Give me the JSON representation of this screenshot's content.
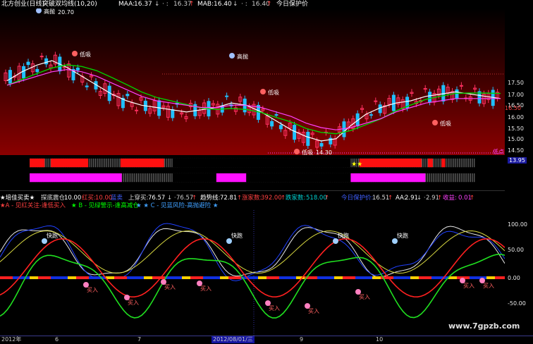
{
  "header": {
    "title": "北方创业(日线)",
    "indicator": "突破双均线(10,20)",
    "maa_label": "MAA:",
    "maa_value": "16.37",
    "maa_value2": "16.37",
    "mab_label": "MAB:",
    "mab_value": "16.40",
    "mab_value2": "16.40",
    "protect_label": "今日保护价"
  },
  "price_axis": {
    "labels": [
      "17.50",
      "17.00",
      "16.50",
      "16.00",
      "15.50",
      "15.00",
      "14.50",
      "13.95"
    ],
    "current_price": "16.50"
  },
  "price_annotations": {
    "high_value": "20.70",
    "low_value": "14.30",
    "high_sell_label": "高抛",
    "low_buy_label": "低吸",
    "low_line_label": "低点"
  },
  "indicator_header": {
    "name": "★培佳买卖★",
    "seg1_label": "探底震仓:",
    "seg1_value": "10.00",
    "seg2_label": "红买:",
    "seg2_value": "10.00",
    "seg3_label": "蓝卖",
    "seg4_label": "上穿买:",
    "seg4_value": "76.57",
    "seg4_value2": "76.57",
    "seg5_label": "趋势线:",
    "seg5_value": "72.81",
    "seg6_label": "涨家数:",
    "seg6_value": "392.00",
    "seg7_label": "跌家数:",
    "seg7_value": "518.00",
    "seg8_label": "今日保护价:",
    "seg8_value": "16.51",
    "seg9_label": "AA:",
    "seg9_value": "2.91",
    "seg9_value2": "2.91",
    "seg10_label": "收益:",
    "seg10_value": "0.01"
  },
  "legend": {
    "a": "★A - 见红关注-逢低买入",
    "b": "★ B - 见绿警示-逢高减仓",
    "c": "★ ★ C - 见蓝风险-高抛避险 ★"
  },
  "osc_axis": {
    "labels": [
      "100.00",
      "50.00",
      "0.00",
      "-50.00"
    ]
  },
  "signals": {
    "run_label": "快跑",
    "buy_label": "买入"
  },
  "date_axis": {
    "year": "2012年",
    "m6": "6",
    "m7": "7",
    "cursor_date": "2012/08/01/三",
    "m9": "9",
    "m10": "10"
  },
  "watermark": "www.7gpzb.com",
  "chart_data": {
    "type": "line",
    "series": [
      {
        "values": [
          17.2,
          17.6,
          17.9,
          18.1,
          17.8,
          17.4,
          17.0,
          16.6,
          16.3,
          16.1,
          16.0,
          15.9,
          15.8,
          15.9,
          16.0,
          16.2,
          16.1,
          15.8,
          15.4,
          15.0,
          14.7,
          14.5,
          14.6,
          15.2,
          15.7,
          16.0,
          16.2,
          16.3,
          16.5,
          16.6,
          16.7,
          16.6,
          16.5,
          16.4
        ]
      },
      {
        "values": [
          17.0,
          17.2,
          17.4,
          17.6,
          17.7,
          17.6,
          17.4,
          17.1,
          16.8,
          16.5,
          16.3,
          16.2,
          16.1,
          16.0,
          16.0,
          16.1,
          16.1,
          16.0,
          15.8,
          15.6,
          15.3,
          15.1,
          15.0,
          15.1,
          15.3,
          15.5,
          15.8,
          16.0,
          16.2,
          16.3,
          16.4,
          16.4,
          16.4,
          16.4
        ]
      }
    ],
    "ylim": [
      13.95,
      21.0
    ]
  }
}
